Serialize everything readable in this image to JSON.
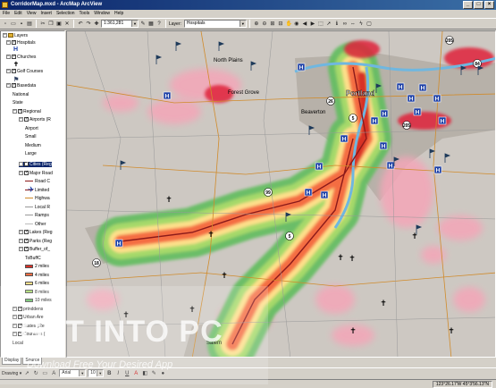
{
  "window": {
    "title": "CorridorMap.mxd - ArcMap ArcView",
    "min": "_",
    "max": "□",
    "close": "×"
  },
  "menu": [
    "File",
    "Edit",
    "View",
    "Insert",
    "Selection",
    "Tools",
    "Window",
    "Help"
  ],
  "toolbar": {
    "scale": "1:361,281",
    "layer_label": "Layer:",
    "layer_value": "Hospitals"
  },
  "toc": {
    "root": "Layers",
    "tabs": [
      "Display",
      "Source"
    ],
    "items": [
      {
        "label": "Hospitals",
        "checked": true
      },
      {
        "label": "Churches",
        "checked": true
      },
      {
        "label": "Golf Courses",
        "checked": true
      },
      {
        "label": "Basedata",
        "checked": true
      },
      {
        "label": "National",
        "checked": false
      },
      {
        "label": "State",
        "checked": false
      },
      {
        "label": "Regional",
        "checked": true
      },
      {
        "label": "Airports (R",
        "checked": true
      },
      {
        "label": "Airport",
        "checked": false
      },
      {
        "label": "Small",
        "checked": false
      },
      {
        "label": "Medium",
        "checked": false
      },
      {
        "label": "Large",
        "checked": false
      },
      {
        "label": "Cities (Reg",
        "checked": true
      },
      {
        "label": "Major Road",
        "checked": true
      },
      {
        "label": "Road C",
        "checked": false
      },
      {
        "label": "Limited",
        "checked": false
      },
      {
        "label": "Highwa",
        "checked": false
      },
      {
        "label": "Local R",
        "checked": false
      },
      {
        "label": "Ramps",
        "checked": false
      },
      {
        "label": "Other",
        "checked": false
      },
      {
        "label": "Lakes (Reg",
        "checked": true
      },
      {
        "label": "Parks (Reg",
        "checked": true
      },
      {
        "label": "Buffer_of_",
        "checked": true
      },
      {
        "label": "ToBuffC",
        "checked": false
      },
      {
        "label": "2 miles",
        "checked": false
      },
      {
        "label": "4 miles",
        "checked": false
      },
      {
        "label": "6 miles",
        "checked": false
      },
      {
        "label": "8 miles",
        "checked": false
      },
      {
        "label": "10 miles",
        "checked": false
      },
      {
        "label": "prtnddens",
        "checked": true
      },
      {
        "label": "Urban Are",
        "checked": true
      },
      {
        "label": "States (Re",
        "checked": true
      },
      {
        "label": "Countries (",
        "checked": true
      },
      {
        "label": "Local",
        "checked": false
      }
    ]
  },
  "map_labels": {
    "portland": "Portland",
    "north_plains": "North Plains",
    "beaverton": "Beaverton",
    "forest_grove": "Forest Grove",
    "salem": "Salem",
    "hwy_5": "5",
    "hwy_26": "26",
    "hwy_205": "205",
    "hwy_99": "99",
    "hwy_84": "84",
    "hwy_18": "18"
  },
  "drawbar": {
    "drawing": "Drawing ▾",
    "font": "Arial",
    "size": "10",
    "bold": "B",
    "italic": "I",
    "underline": "U"
  },
  "status": {
    "coords": "123°26.17'W  45°3'56.13\"N"
  },
  "watermark": {
    "title": "GET INTO PC",
    "subtitle": "Download Free Your Desired App"
  },
  "colors": {
    "buffer2": "#d73027",
    "buffer4": "#f46d43",
    "buffer6": "#fee08b",
    "buffer8": "#a6d96a",
    "buffer10": "#66bd63",
    "density": "#f4a6b8",
    "urban": "#b8b0a8"
  }
}
